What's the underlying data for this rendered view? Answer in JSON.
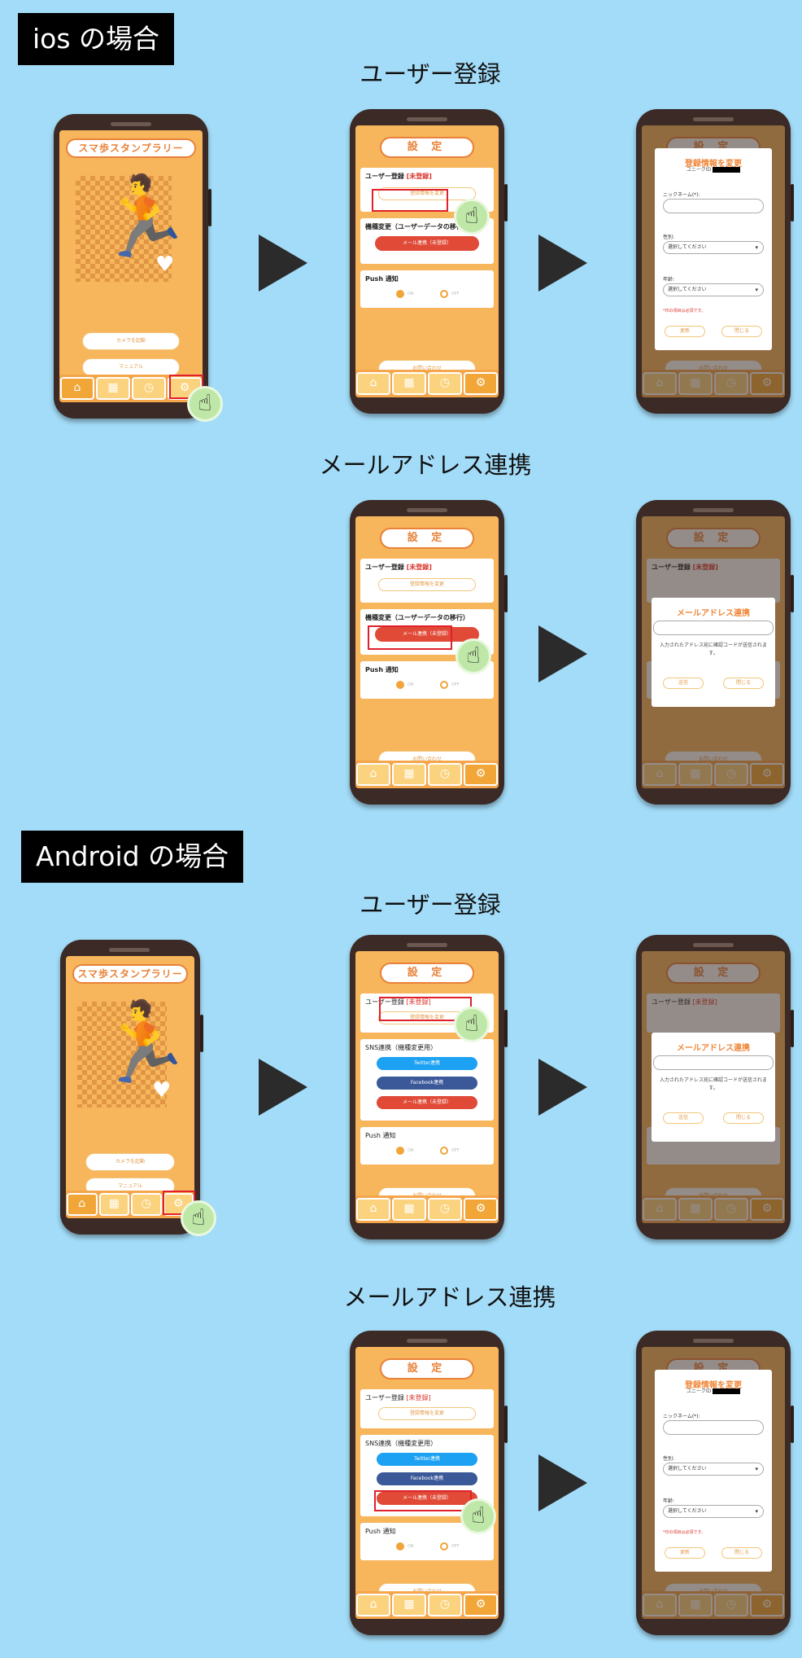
{
  "sections": {
    "ios": "ios の場合",
    "android": "Android の場合"
  },
  "subtitles": {
    "user_reg": "ユーザー登録",
    "mail_link": "メールアドレス連携"
  },
  "home": {
    "title": "スマ歩スタンプラリー",
    "camera_btn": "カメラを起動",
    "manual_btn": "マニュアル"
  },
  "settings": {
    "title": "設 定",
    "user_reg_label": "ユーザー登録",
    "unregistered": "[未登録]",
    "change_info_btn": "登録情報を変更",
    "migration_label": "機種変更（ユーザーデータの移行）",
    "mail_link_btn": "メール連携（未登録）",
    "sns_label": "SNS連携（機種変更用）",
    "twitter_btn": "Twitter連携",
    "facebook_btn": "Facebook連携",
    "push_label": "Push 通知",
    "on": "ON",
    "off": "OFF",
    "contact_btn": "お問い合わせ"
  },
  "reg_modal": {
    "title": "登録情報を変更",
    "unique_id_label": "ユニークID",
    "nickname_label": "ニックネーム(*):",
    "gender_label": "性別:",
    "age_label": "年齢:",
    "select_placeholder": "選択してください",
    "required_note": "*印の項目は必須です。",
    "update_btn": "更新",
    "close_btn": "閉じる"
  },
  "mail_modal": {
    "title": "メールアドレス連携",
    "message": "入力されたアドレス宛に確認コードが送信されます。",
    "send_btn": "送信",
    "close_btn": "閉じる"
  },
  "icons": {
    "home": "⌂",
    "grid": "▦",
    "clock": "◷",
    "gear": "⚙",
    "hand": "☝",
    "camera": "📷"
  },
  "colors": {
    "background": "#a3dcf8",
    "screen": "#f7b55c",
    "accent": "#e8823a",
    "red_button": "#e04a37",
    "twitter": "#1da1f2",
    "facebook": "#3b5998",
    "highlight": "#e0202a"
  }
}
